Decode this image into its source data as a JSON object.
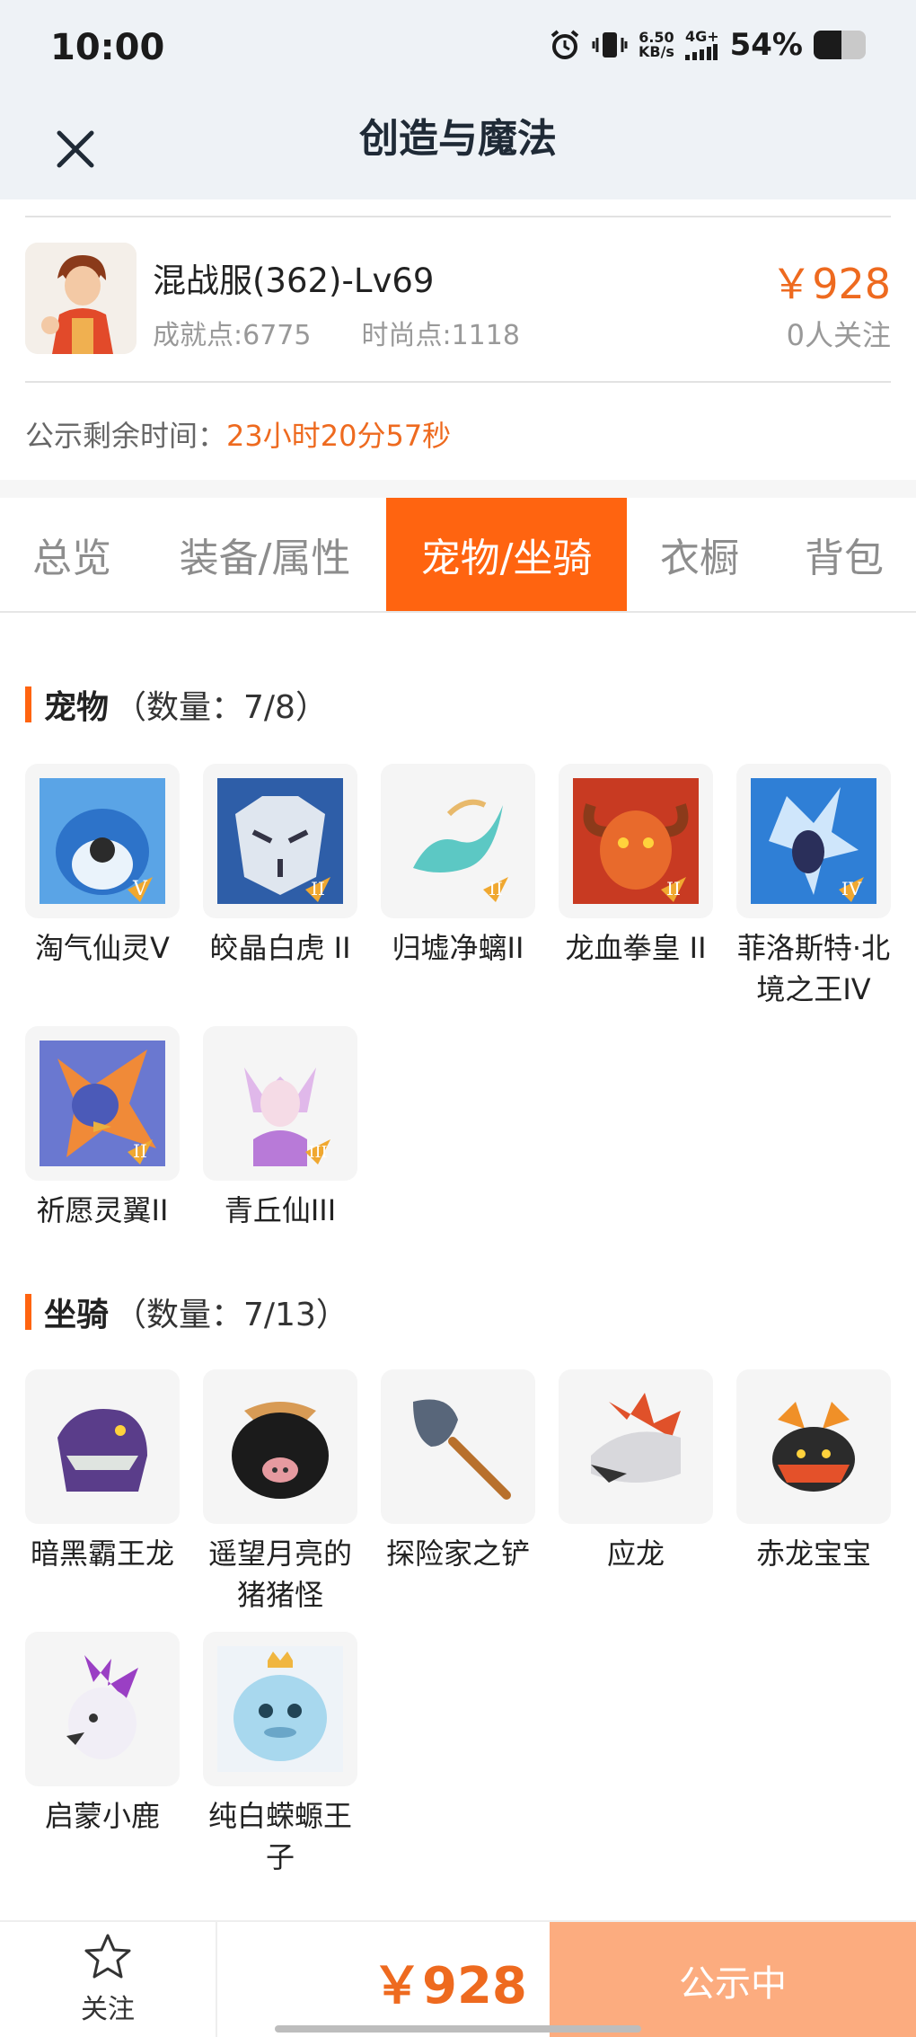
{
  "status_bar": {
    "time": "10:00",
    "net_speed_value": "6.50",
    "net_speed_unit": "KB/s",
    "network_type": "4G+",
    "battery_percent": "54%",
    "battery_level": 0.54
  },
  "header": {
    "title": "创造与魔法",
    "close_icon": "close-icon"
  },
  "account": {
    "name": "混战服(362)-Lv69",
    "achievement": "成就点:6775",
    "fashion": "时尚点:1118",
    "price": "￥928",
    "followers": "0人关注"
  },
  "countdown": {
    "label": "公示剩余时间：",
    "value": "23小时20分57秒"
  },
  "tabs": [
    {
      "label": "总览",
      "active": false
    },
    {
      "label": "装备/属性",
      "active": false
    },
    {
      "label": "宠物/坐骑",
      "active": true
    },
    {
      "label": "衣橱",
      "active": false
    },
    {
      "label": "背包",
      "active": false
    }
  ],
  "pets": {
    "title": "宠物",
    "count": "（数量：7/8）",
    "items": [
      {
        "name": "淘气仙灵V",
        "badge": "V"
      },
      {
        "name": "皎晶白虎 II",
        "badge": "II"
      },
      {
        "name": "归墟净螭II",
        "badge": "II"
      },
      {
        "name": "龙血拳皇 II",
        "badge": "II"
      },
      {
        "name": "菲洛斯特·北境之王IV",
        "badge": "IV"
      },
      {
        "name": "祈愿灵翼II",
        "badge": "II"
      },
      {
        "name": "青丘仙III",
        "badge": "III"
      }
    ]
  },
  "mounts": {
    "title": "坐骑",
    "count": "（数量：7/13）",
    "items": [
      {
        "name": "暗黑霸王龙"
      },
      {
        "name": "遥望月亮的猪猪怪"
      },
      {
        "name": "探险家之铲"
      },
      {
        "name": "应龙"
      },
      {
        "name": "赤龙宝宝"
      },
      {
        "name": "启蒙小鹿"
      },
      {
        "name": "纯白蝾螈王子"
      }
    ]
  },
  "bottom": {
    "follow_label": "关注",
    "price": "￥928",
    "status_button": "公示中"
  },
  "colors": {
    "accent": "#ff6410",
    "price": "#ee6a1f",
    "button_disabled": "#fcac7f"
  }
}
